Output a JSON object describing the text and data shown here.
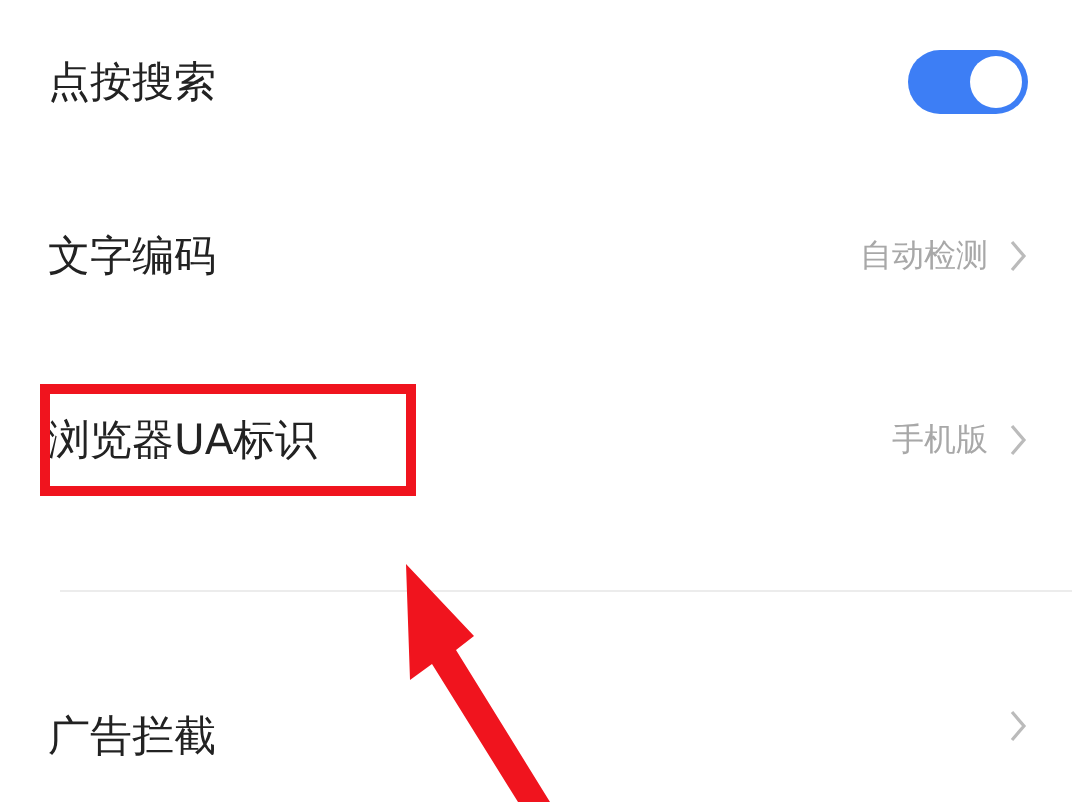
{
  "settings": [
    {
      "kind": "toggle",
      "label": "点按搜索",
      "on": true,
      "highlighted": false
    },
    {
      "kind": "link",
      "label": "文字编码",
      "value": "自动检测",
      "highlighted": false
    },
    {
      "kind": "link",
      "label": "浏览器UA标识",
      "value": "手机版",
      "highlighted": true
    },
    {
      "kind": "link",
      "label": "广告拦截",
      "highlighted": false
    }
  ]
}
